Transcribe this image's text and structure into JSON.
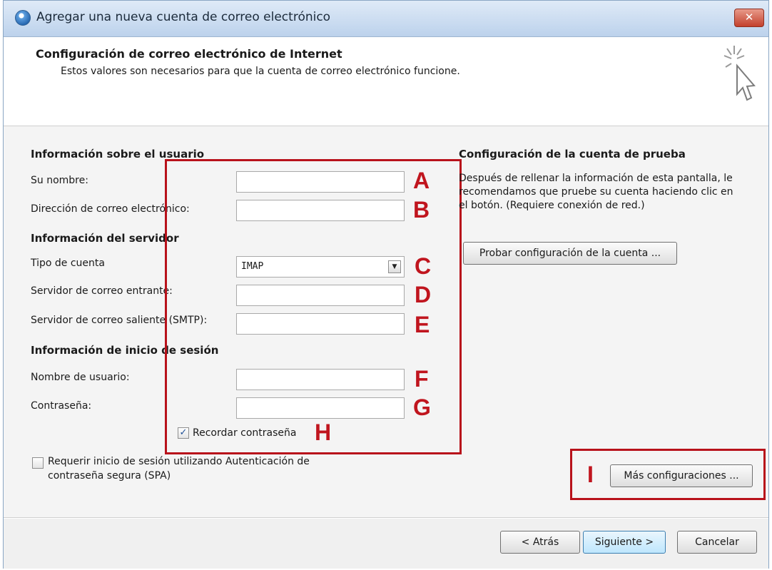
{
  "window": {
    "title": "Agregar una nueva cuenta de correo electrónico",
    "close_label": "✕"
  },
  "header": {
    "title": "Configuración de correo electrónico de Internet",
    "subtitle": "Estos valores son necesarios para que la cuenta de correo electrónico funcione."
  },
  "user_section": {
    "heading": "Información sobre el usuario",
    "name_label": "Su nombre:",
    "email_label": "Dirección de correo electrónico:",
    "name_value": "",
    "email_value": ""
  },
  "server_section": {
    "heading": "Información del servidor",
    "account_type_label": "Tipo de cuenta",
    "account_type_value": "IMAP",
    "incoming_label": "Servidor de correo entrante:",
    "outgoing_label": "Servidor de correo saliente (SMTP):",
    "incoming_value": "",
    "outgoing_value": ""
  },
  "login_section": {
    "heading": "Información de inicio de sesión",
    "username_label": "Nombre de usuario:",
    "password_label": "Contraseña:",
    "username_value": "",
    "password_value": "",
    "remember_label": "Recordar contraseña",
    "remember_checked": true,
    "spa_label_line1": "Requerir inicio de sesión utilizando Autenticación de",
    "spa_label_line2": "contraseña segura (SPA)",
    "spa_checked": false
  },
  "test_section": {
    "heading": "Configuración de la cuenta de prueba",
    "description_line1": "Después de rellenar la información de esta pantalla, le",
    "description_line2": "recomendamos que pruebe su cuenta haciendo clic en",
    "description_line3": "el botón. (Requiere conexión de red.)",
    "test_button": "Probar configuración de la cuenta ..."
  },
  "more_settings_button": "Más configuraciones ...",
  "footer": {
    "back_button": "< Atrás",
    "next_button": "Siguiente >",
    "cancel_button": "Cancelar"
  },
  "markers": {
    "a": "A",
    "b": "B",
    "c": "C",
    "d": "D",
    "e": "E",
    "f": "F",
    "g": "G",
    "h": "H",
    "i": "I"
  },
  "icons": {
    "checkmark": "✓",
    "dropdown": "▼"
  },
  "colors": {
    "annotation_red": "#c0151e",
    "titlebar": "#bcd2ec"
  }
}
